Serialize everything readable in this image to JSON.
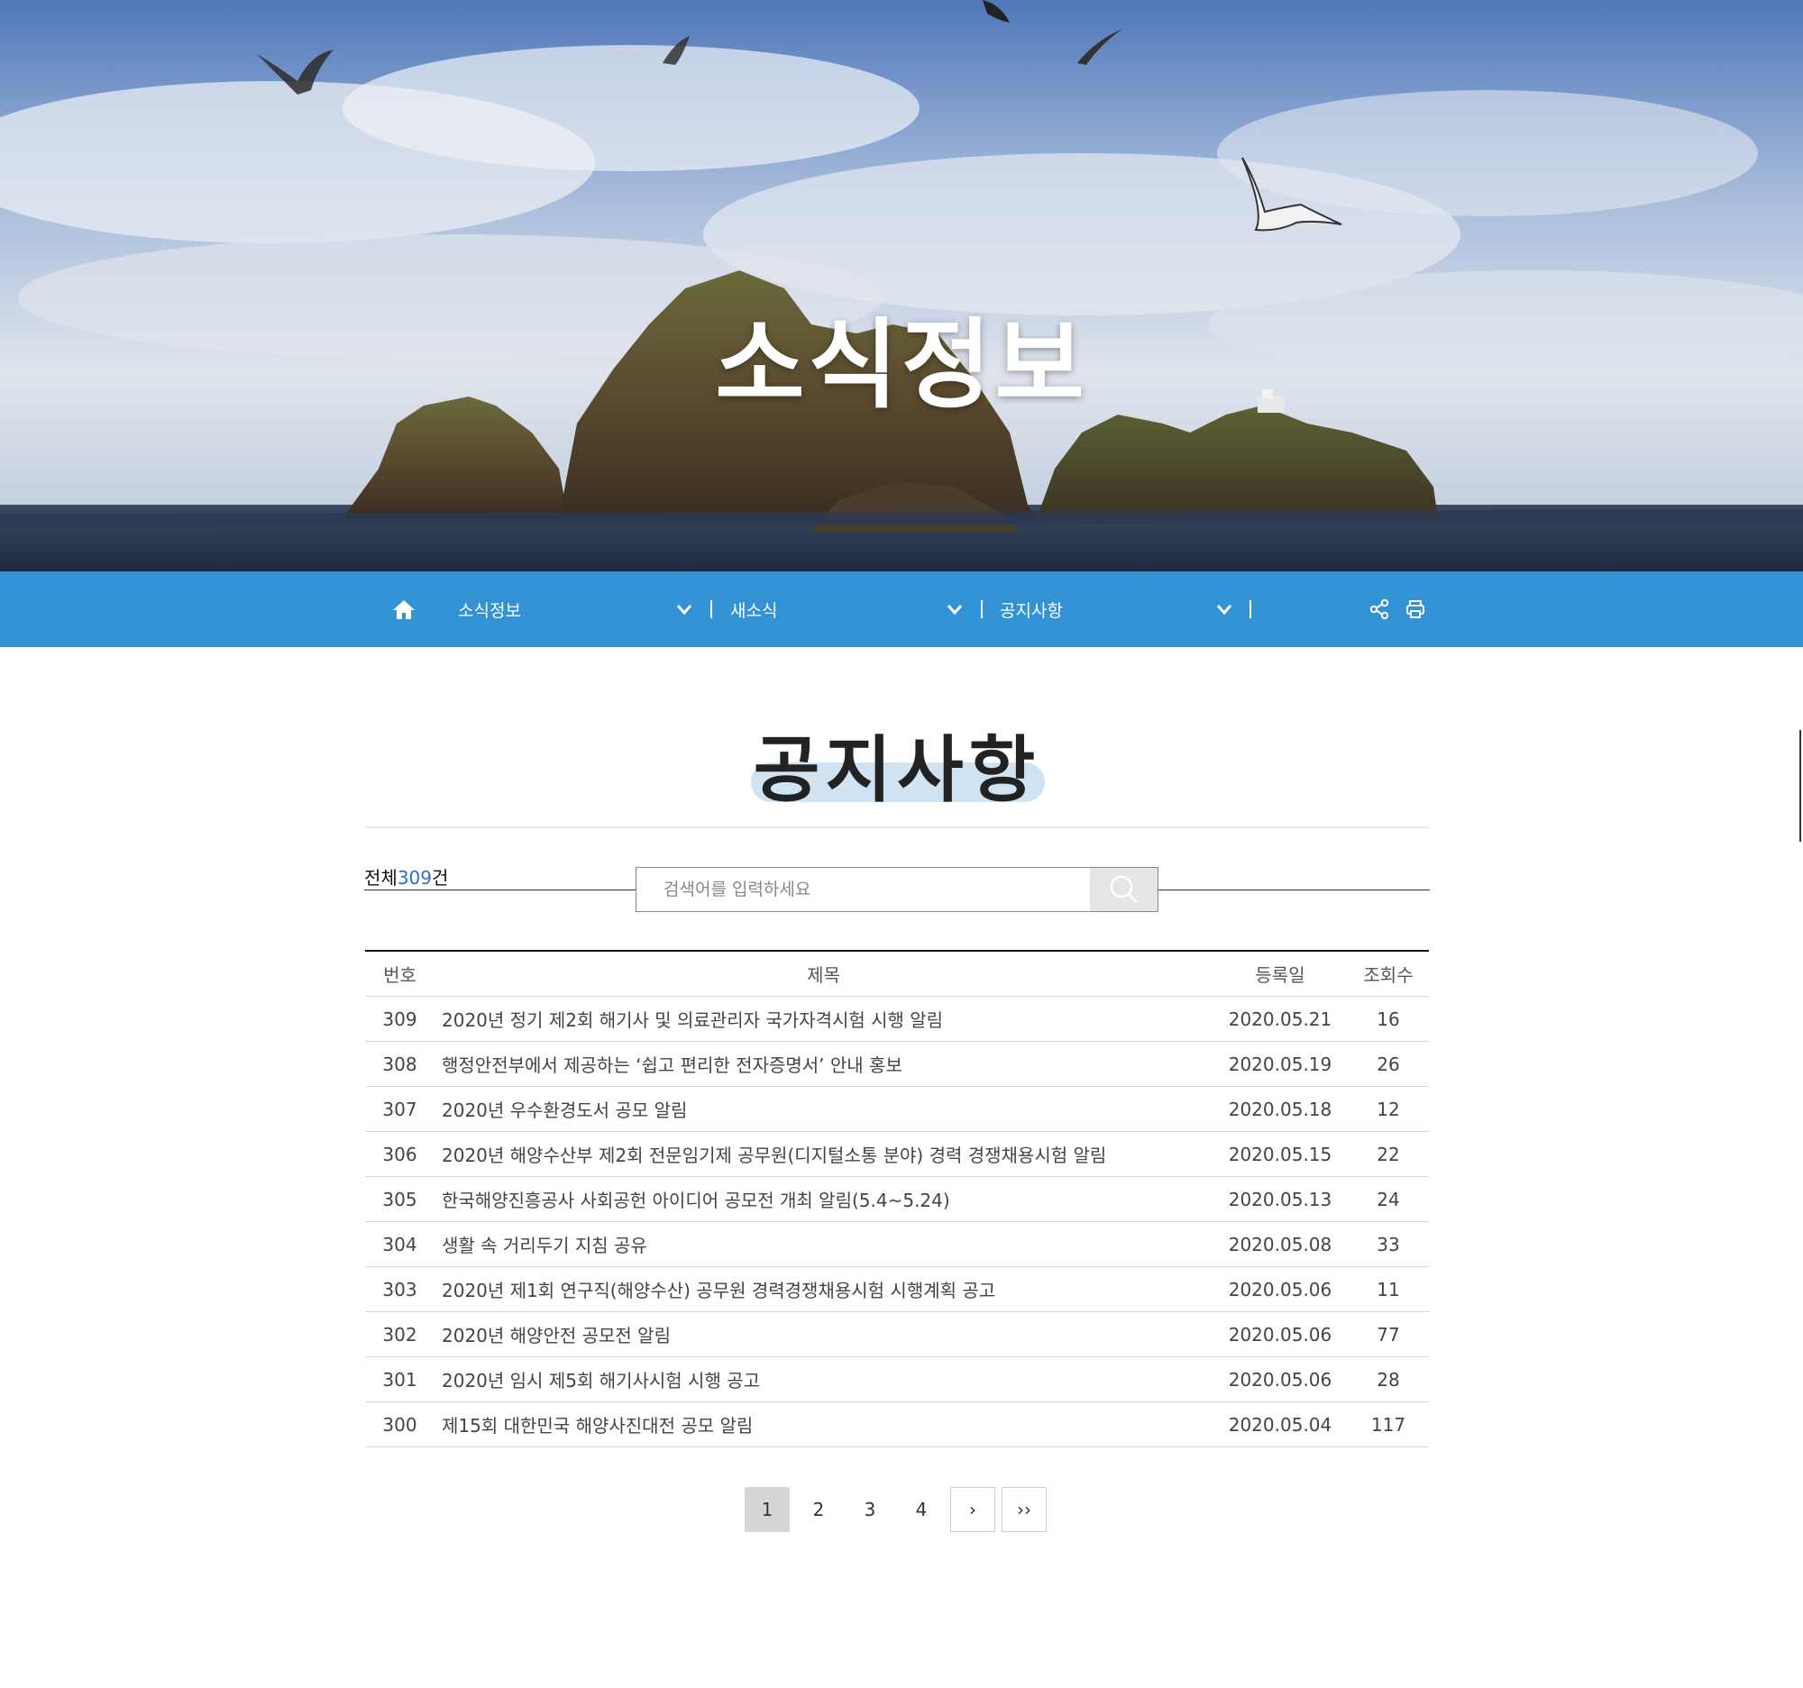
{
  "hero": {
    "title": "소식정보"
  },
  "nav": {
    "items": [
      {
        "label": "소식정보"
      },
      {
        "label": "새소식"
      },
      {
        "label": "공지사항"
      }
    ]
  },
  "page": {
    "title": "공지사항"
  },
  "list": {
    "count_prefix": "전체",
    "count": "309",
    "count_suffix": "건",
    "search_placeholder": "검색어를 입력하세요",
    "headers": {
      "no": "번호",
      "title": "제목",
      "date": "등록일",
      "views": "조회수"
    },
    "rows": [
      {
        "no": "309",
        "title": "2020년 정기 제2회 해기사 및 의료관리자 국가자격시험 시행 알림",
        "date": "2020.05.21",
        "views": "16"
      },
      {
        "no": "308",
        "title": "행정안전부에서 제공하는 ‘쉽고 편리한 전자증명서’ 안내 홍보",
        "date": "2020.05.19",
        "views": "26"
      },
      {
        "no": "307",
        "title": "2020년 우수환경도서 공모 알림",
        "date": "2020.05.18",
        "views": "12"
      },
      {
        "no": "306",
        "title": "2020년 해양수산부 제2회 전문임기제 공무원(디지털소통 분야) 경력 경쟁채용시험 알림",
        "date": "2020.05.15",
        "views": "22"
      },
      {
        "no": "305",
        "title": "한국해양진흥공사 사회공헌 아이디어 공모전 개최 알림(5.4~5.24)",
        "date": "2020.05.13",
        "views": "24"
      },
      {
        "no": "304",
        "title": "생활 속 거리두기 지침 공유",
        "date": "2020.05.08",
        "views": "33"
      },
      {
        "no": "303",
        "title": "2020년 제1회 연구직(해양수산) 공무원 경력경쟁채용시험 시행계획 공고",
        "date": "2020.05.06",
        "views": "11"
      },
      {
        "no": "302",
        "title": "2020년 해양안전 공모전 알림",
        "date": "2020.05.06",
        "views": "77"
      },
      {
        "no": "301",
        "title": "2020년 임시 제5회 해기사시험 시행 공고",
        "date": "2020.05.06",
        "views": "28"
      },
      {
        "no": "300",
        "title": "제15회 대한민국 해양사진대전 공모 알림",
        "date": "2020.05.04",
        "views": "117"
      }
    ]
  },
  "pagination": {
    "pages": [
      "1",
      "2",
      "3",
      "4"
    ],
    "active": "1",
    "next": "›",
    "last": "››"
  },
  "colors": {
    "nav_bg": "#3392d3",
    "count_accent": "#2b6fc8",
    "title_highlight": "#cfe3f3",
    "active_page": "#d6d6d6"
  },
  "icons": {
    "home": "home-icon",
    "chevron": "chevron-down-icon",
    "share": "share-icon",
    "print": "print-icon",
    "search": "search-icon"
  }
}
